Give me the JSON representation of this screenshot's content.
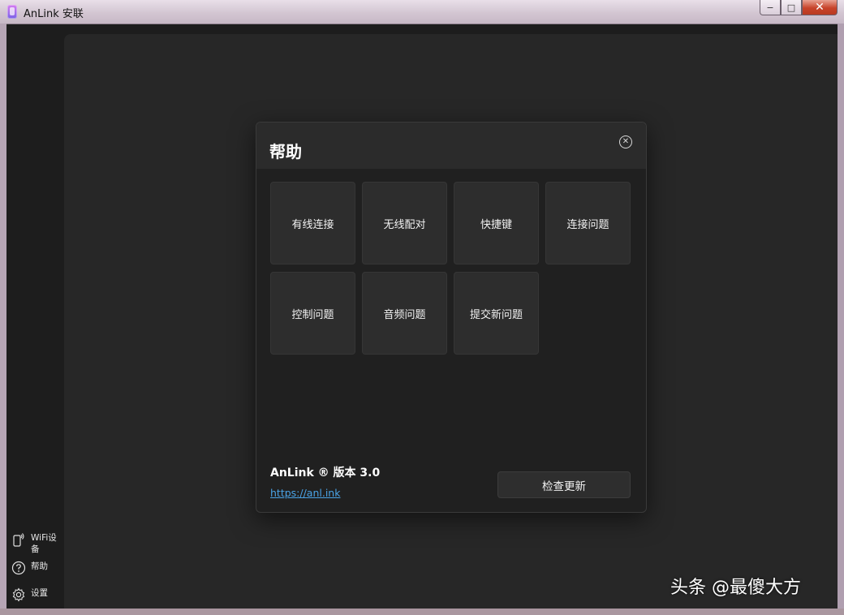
{
  "window": {
    "title": "AnLink 安联",
    "controls": {
      "minimize": "−",
      "maximize": "□",
      "close": "✕"
    }
  },
  "sidebar": {
    "items": [
      {
        "label": "WiFi设备",
        "icon": "phone-wifi-icon"
      },
      {
        "label": "帮助",
        "icon": "help-circle-icon"
      },
      {
        "label": "设置",
        "icon": "gear-icon"
      }
    ]
  },
  "help_dialog": {
    "title": "帮助",
    "close_icon": "close-circle-icon",
    "tiles": [
      {
        "label": "有线连接"
      },
      {
        "label": "无线配对"
      },
      {
        "label": "快捷键"
      },
      {
        "label": "连接问题"
      },
      {
        "label": "控制问题"
      },
      {
        "label": "音频问题"
      },
      {
        "label": "提交新问题"
      }
    ],
    "version": "AnLink ® 版本 3.0",
    "link": "https://anl.ink",
    "update_button": "检查更新"
  },
  "watermark": "头条 @最傻大方",
  "colors": {
    "background": "#1d1d1d",
    "content": "#272727",
    "dialog": "#202020",
    "tile": "#2d2d2d",
    "link": "#4aa3e6"
  }
}
